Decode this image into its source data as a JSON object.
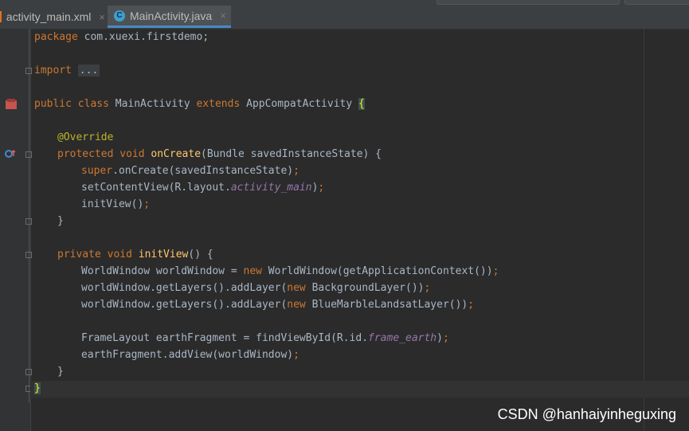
{
  "tabs": [
    {
      "label": "activity_main.xml",
      "close": "×"
    },
    {
      "label": "MainActivity.java",
      "close": "×",
      "icon": "C"
    }
  ],
  "code": {
    "l1": [
      "package",
      " com.xuexi.firstdemo;"
    ],
    "l3": [
      "import",
      " ",
      "..."
    ],
    "l5": [
      "public class",
      " MainActivity ",
      "extends",
      " AppCompatActivity ",
      "{"
    ],
    "l7": [
      "@Override"
    ],
    "l8": [
      "protected void",
      " ",
      "onCreate",
      "(Bundle savedInstanceState) {"
    ],
    "l9": [
      "super",
      ".onCreate(savedInstanceState)",
      ";"
    ],
    "l10": [
      "setContentView(R.layout.",
      "activity_main",
      ")",
      ";"
    ],
    "l11": [
      "initView()",
      ";"
    ],
    "l12": [
      "}"
    ],
    "l14": [
      "private void",
      " ",
      "initView",
      "() {"
    ],
    "l15": [
      "WorldWindow worldWindow = ",
      "new",
      " WorldWindow(getApplicationContext())",
      ";"
    ],
    "l16": [
      "worldWindow.getLayers().addLayer(",
      "new",
      " BackgroundLayer())",
      ";"
    ],
    "l17": [
      "worldWindow.getLayers().addLayer(",
      "new",
      " BlueMarbleLandsatLayer())",
      ";"
    ],
    "l19": [
      "FrameLayout earthFragment = findViewById(R.id.",
      "frame_earth",
      ")",
      ";"
    ],
    "l20": [
      "earthFragment.addView(worldWindow)",
      ";"
    ],
    "l21": [
      "}"
    ],
    "l22": [
      "}"
    ]
  },
  "watermark": "CSDN @hanhaiyinheguxing"
}
